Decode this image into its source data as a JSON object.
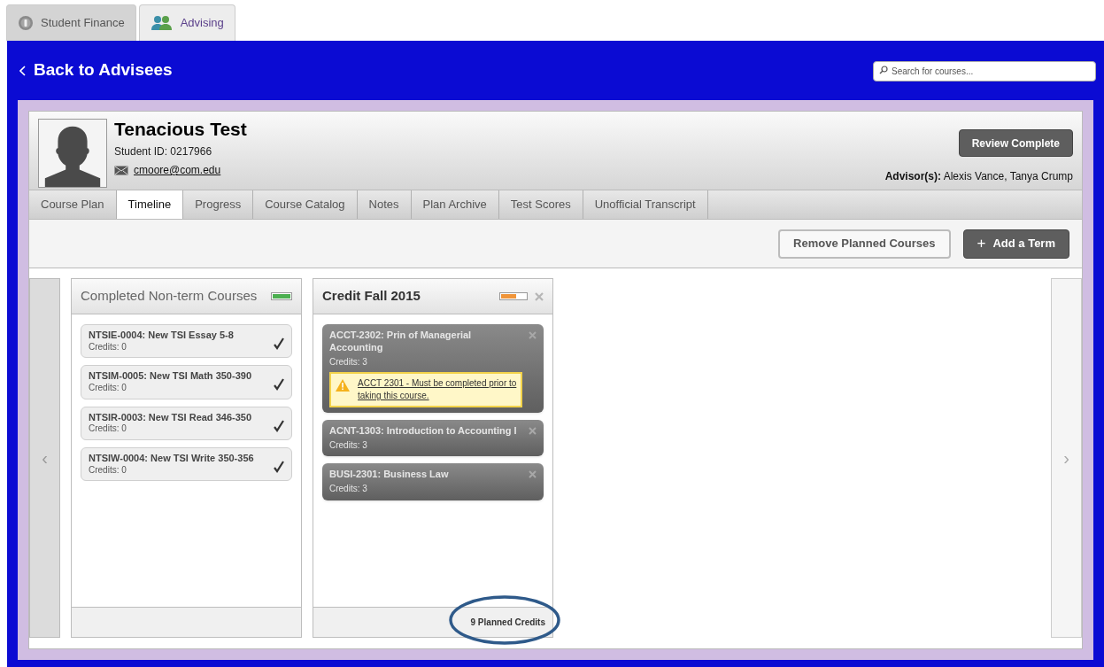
{
  "app_tabs": [
    {
      "label": "Student Finance",
      "selected": false
    },
    {
      "label": "Advising",
      "selected": true
    }
  ],
  "header": {
    "back_link": "Back to Advisees",
    "search": {
      "placeholder": "Search for courses..."
    }
  },
  "student": {
    "name": "Tenacious Test",
    "id_line": "Student ID: 0217966",
    "email": "cmoore@com.edu",
    "review_button": "Review Complete",
    "advisors_label": "Advisor(s):",
    "advisors": "Alexis Vance, Tanya Crump"
  },
  "tabs": [
    {
      "label": "Course Plan",
      "selected": false
    },
    {
      "label": "Timeline",
      "selected": true
    },
    {
      "label": "Progress",
      "selected": false
    },
    {
      "label": "Course Catalog",
      "selected": false
    },
    {
      "label": "Notes",
      "selected": false
    },
    {
      "label": "Plan Archive",
      "selected": false
    },
    {
      "label": "Test Scores",
      "selected": false
    },
    {
      "label": "Unofficial Transcript",
      "selected": false
    }
  ],
  "toolbar": {
    "remove_button": "Remove Planned Courses",
    "add_button": "Add a Term",
    "add_icon": "+"
  },
  "nav": {
    "prev": "‹",
    "next": "›"
  },
  "terms": [
    {
      "title": "Completed Non-term Courses",
      "level": 1,
      "color": "#4caf50",
      "removable": false,
      "courses": [
        {
          "kind": "completed",
          "title": "NTSIE-0004: New TSI Essay 5-8",
          "credits": "Credits: 0"
        },
        {
          "kind": "completed",
          "title": "NTSIM-0005: New TSI Math 350-390",
          "credits": "Credits: 0"
        },
        {
          "kind": "completed",
          "title": "NTSIR-0003: New TSI Read 346-350",
          "credits": "Credits: 0"
        },
        {
          "kind": "completed",
          "title": "NTSIW-0004: New TSI Write 350-356",
          "credits": "Credits: 0"
        }
      ]
    },
    {
      "title": "Credit Fall 2015",
      "level": 0.6,
      "color": "#f0953a",
      "removable": true,
      "footer": "9 Planned Credits",
      "courses": [
        {
          "kind": "planned",
          "title": "ACCT-2302: Prin of Managerial Accounting",
          "credits": "Credits: 3",
          "warning": "ACCT 2301 - Must be completed prior to taking this course."
        },
        {
          "kind": "planned",
          "title": "ACNT-1303: Introduction to Accounting I",
          "credits": "Credits: 3"
        },
        {
          "kind": "planned",
          "title": "BUSI-2301: Business Law",
          "credits": "Credits: 3"
        }
      ]
    }
  ]
}
